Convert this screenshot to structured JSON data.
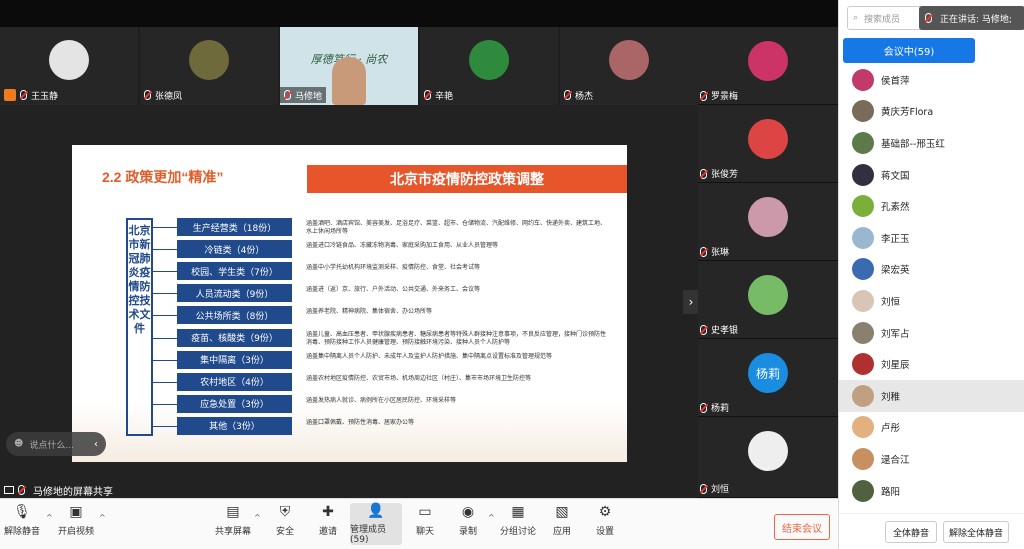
{
  "thumbs": [
    {
      "name": "王玉静",
      "avatar": "#e4e4e4",
      "host": true
    },
    {
      "name": "张德凤",
      "avatar": "#6f6a3c"
    },
    {
      "name": "马修地",
      "avatar": "#7aa"
    },
    {
      "name": "辛艳",
      "avatar": "#2e8b3d"
    },
    {
      "name": "杨杰",
      "avatar": "#a66"
    }
  ],
  "speaker_banner": "厚德笃行 ·  尚农",
  "right_thumbs": [
    {
      "name": "罗景梅",
      "avatar": "#c36"
    },
    {
      "name": "张俊芳",
      "avatar": "#d44"
    },
    {
      "name": "张琳",
      "avatar": "#c9a"
    },
    {
      "name": "史孝银",
      "avatar": "#7b6"
    },
    {
      "name": "杨莉",
      "avatar": "#1a8de0",
      "initials": "杨莉"
    },
    {
      "name": "刘恒",
      "avatar": "#fff"
    }
  ],
  "slide": {
    "section": "2.2 政策更加“精准”",
    "banner": "北京市疫情防控政策调整",
    "vertical": "北京市新冠肺炎疫情防控技术文件",
    "categories": [
      {
        "label": "生产经营类（18份）",
        "desc": "涵盖酒吧、酒店宾馆、美容美发、足浴足疗、菜篮、超市、仓储物流、汽配维修、网约车、快递外卖、建筑工地、水上休闲场所等"
      },
      {
        "label": "冷链类（4份）",
        "desc": "涵盖进口冷链食品、冻藏冻物消毒、家庭采购加工食用、从业人员管理等"
      },
      {
        "label": "校园、学生类（7份）",
        "desc": "涵盖中小学托幼机构环境监测采样、疫情防控、食堂、社会考试等"
      },
      {
        "label": "人员流动类（9份）",
        "desc": "涵盖进（返）京、旅行、户外活动、公共交通、外来务工、会议等"
      },
      {
        "label": "公共场所类（8份）",
        "desc": "涵盖养老院、精神病院、集体宿舍、办公场所等"
      },
      {
        "label": "疫苗、核酸类（9份）",
        "desc": "涵盖儿童、高血压患者、甲状腺疾病患者、糖尿病患者等特殊人群接种注意事项，不良反应管理，接种门诊预防性消毒、预防接种工作人员健康管理、预防接触环境污染、接种人员个人防护等"
      },
      {
        "label": "集中隔离（3份）",
        "desc": "涵盖集中隔离人员个人防护、未成年人及监护人防护措施、集中隔离点设置标准及管理规范等"
      },
      {
        "label": "农村地区（4份）",
        "desc": "涵盖农村地区疫情防控、农贸市场、机场周边社区（村庄）、集市市场环境卫生防控等"
      },
      {
        "label": "应急处置（3份）",
        "desc": "涵盖发热病人就诊、病例所在小区居民防控、环境采样等"
      },
      {
        "label": "其他（3份）",
        "desc": "涵盖口罩佩戴、预防性消毒、居家办公等"
      }
    ]
  },
  "chat_placeholder": "说点什么...",
  "share_label": "马修地的屏幕共享",
  "toolbar": [
    {
      "label": "解除静音",
      "icon": "mic-off-icon"
    },
    {
      "label": "开启视频",
      "icon": "video-off-icon"
    },
    {
      "label": "共享屏幕",
      "icon": "share-screen-icon"
    },
    {
      "label": "安全",
      "icon": "shield-icon"
    },
    {
      "label": "邀请",
      "icon": "invite-icon"
    },
    {
      "label": "管理成员(59)",
      "icon": "members-icon"
    },
    {
      "label": "聊天",
      "icon": "chat-icon"
    },
    {
      "label": "录制",
      "icon": "record-icon"
    },
    {
      "label": "分组讨论",
      "icon": "breakout-icon"
    },
    {
      "label": "应用",
      "icon": "apps-icon"
    },
    {
      "label": "设置",
      "icon": "gear-icon"
    }
  ],
  "end_meeting": "结束会议",
  "panel": {
    "search_placeholder": "搜索成员",
    "speaking": "正在讲话: 马修地;",
    "tab": "会议中(59)",
    "members": [
      {
        "name": "侯首萍",
        "color": "#c23a6a"
      },
      {
        "name": "黄庆芳Flora",
        "color": "#7a6a5a"
      },
      {
        "name": "基础部--邢玉红",
        "color": "#5c7a4a"
      },
      {
        "name": "蒋文国",
        "color": "#303040"
      },
      {
        "name": "孔素然",
        "color": "#7ab03a"
      },
      {
        "name": "李正玉",
        "color": "#9ab7d0"
      },
      {
        "name": "梁宏英",
        "color": "#3a6ab0"
      },
      {
        "name": "刘恒",
        "color": "#d9c5b5"
      },
      {
        "name": "刘军占",
        "color": "#8a8070"
      },
      {
        "name": "刘星辰",
        "color": "#b03030"
      },
      {
        "name": "刘稚",
        "color": "#c0a080",
        "selected": true
      },
      {
        "name": "卢彤",
        "color": "#e3b080"
      },
      {
        "name": "逯合江",
        "color": "#c89060"
      },
      {
        "name": "路阳",
        "color": "#506040"
      }
    ],
    "mute_all": "全体静音",
    "unmute_all": "解除全体静音"
  }
}
